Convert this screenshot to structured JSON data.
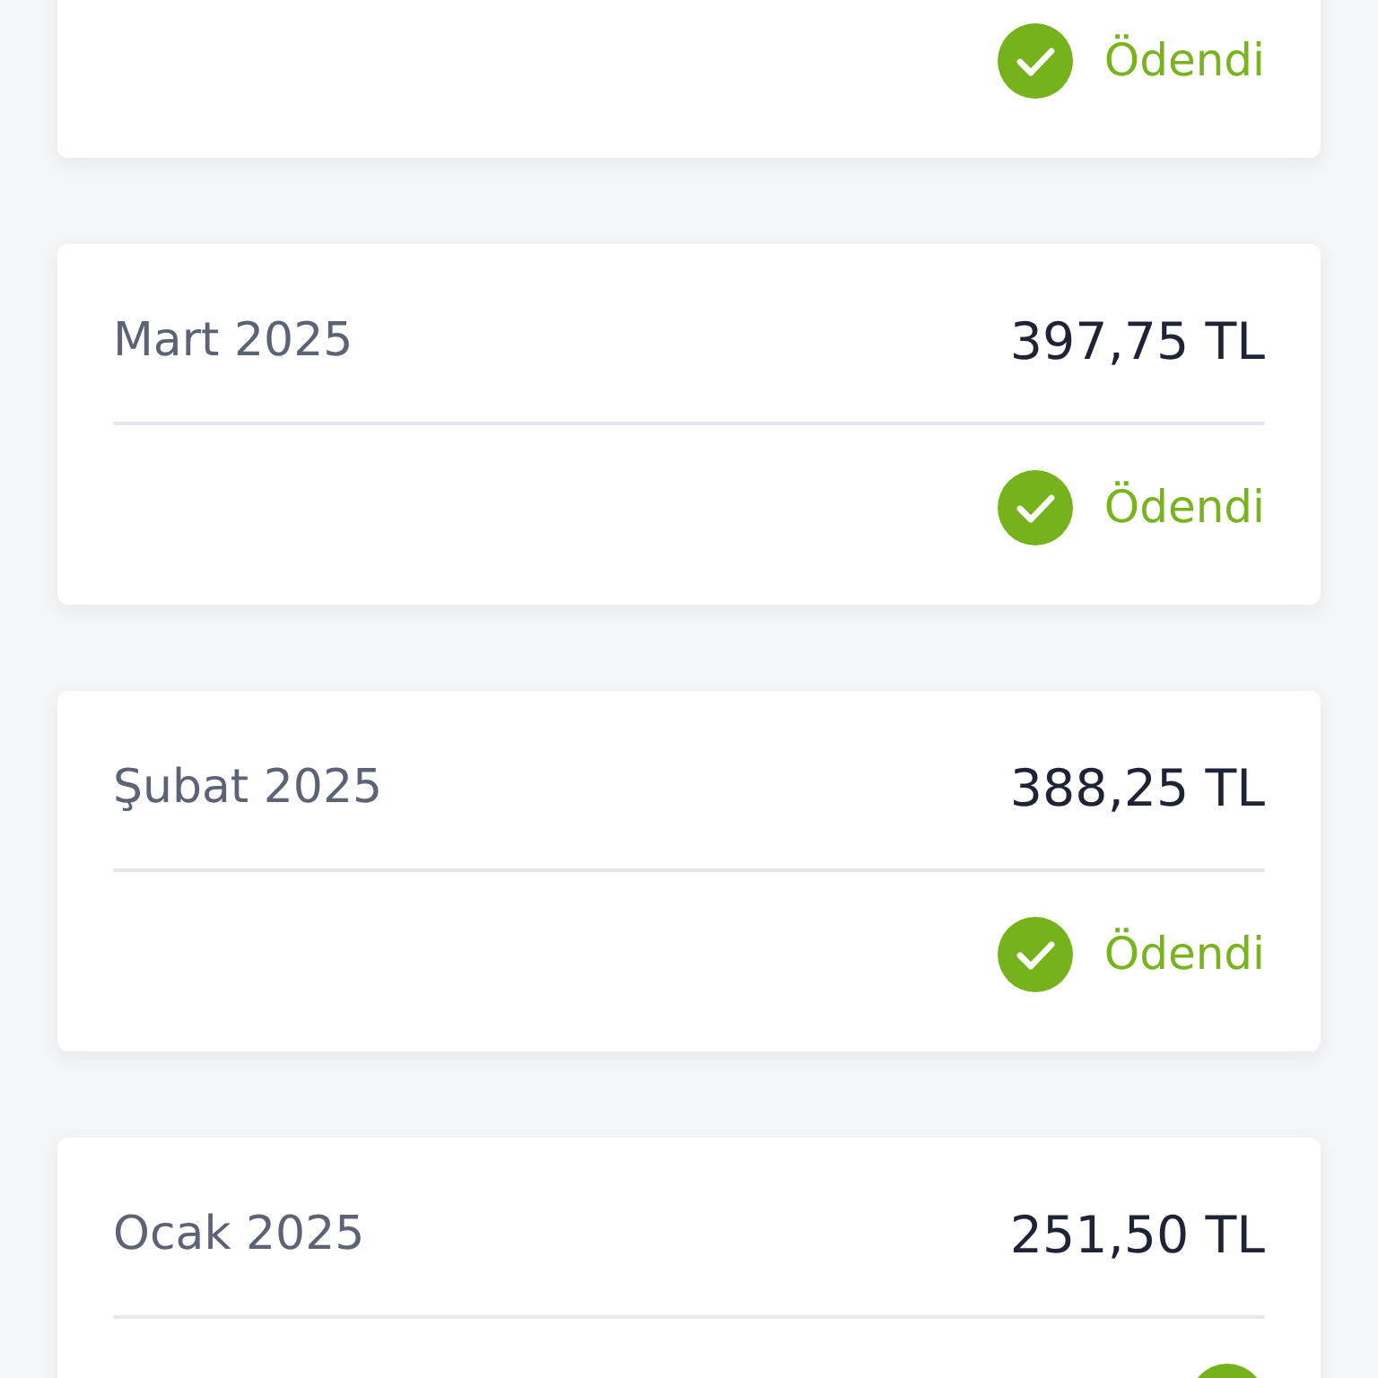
{
  "payments": [
    {
      "status": {
        "kind": "paid",
        "label": "Ödendi"
      }
    },
    {
      "month": "Mart 2025",
      "amount": "397,75 TL",
      "status": {
        "kind": "paid",
        "label": "Ödendi"
      }
    },
    {
      "month": "Şubat 2025",
      "amount": "388,25 TL",
      "status": {
        "kind": "paid",
        "label": "Ödendi"
      }
    },
    {
      "month": "Ocak 2025",
      "amount": "251,50 TL",
      "status": {
        "kind": "paid"
      }
    }
  ]
}
